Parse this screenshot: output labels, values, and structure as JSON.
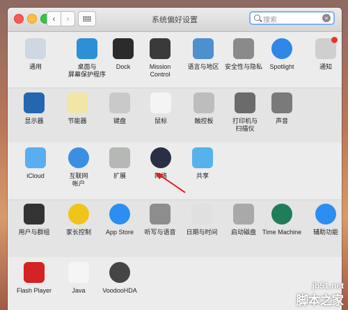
{
  "window": {
    "title": "系统偏好设置"
  },
  "search": {
    "placeholder": "搜索"
  },
  "rows": [
    [
      {
        "label": "通用",
        "icon": "general-icon"
      },
      {
        "label": "桌面与\n屏幕保护程序",
        "icon": "desktop-screensaver-icon"
      },
      {
        "label": "Dock",
        "icon": "dock-icon"
      },
      {
        "label": "Mission\nControl",
        "icon": "mission-control-icon"
      },
      {
        "label": "语言与地区",
        "icon": "language-region-icon"
      },
      {
        "label": "安全性与隐私",
        "icon": "security-privacy-icon"
      },
      {
        "label": "Spotlight",
        "icon": "spotlight-icon"
      },
      {
        "label": "通知",
        "icon": "notifications-icon"
      }
    ],
    [
      {
        "label": "显示器",
        "icon": "displays-icon"
      },
      {
        "label": "节能器",
        "icon": "energy-saver-icon"
      },
      {
        "label": "键盘",
        "icon": "keyboard-icon"
      },
      {
        "label": "鼠标",
        "icon": "mouse-icon"
      },
      {
        "label": "触控板",
        "icon": "trackpad-icon"
      },
      {
        "label": "打印机与\n扫描仪",
        "icon": "printers-scanners-icon"
      },
      {
        "label": "声音",
        "icon": "sound-icon"
      }
    ],
    [
      {
        "label": "iCloud",
        "icon": "icloud-icon"
      },
      {
        "label": "互联网\n帐户",
        "icon": "internet-accounts-icon"
      },
      {
        "label": "扩展",
        "icon": "extensions-icon"
      },
      {
        "label": "网络",
        "icon": "network-icon"
      },
      {
        "label": "共享",
        "icon": "sharing-icon"
      }
    ],
    [
      {
        "label": "用户与群组",
        "icon": "users-groups-icon"
      },
      {
        "label": "家长控制",
        "icon": "parental-controls-icon"
      },
      {
        "label": "App Store",
        "icon": "app-store-icon"
      },
      {
        "label": "听写与语音",
        "icon": "dictation-speech-icon"
      },
      {
        "label": "日期与时间",
        "icon": "date-time-icon"
      },
      {
        "label": "启动磁盘",
        "icon": "startup-disk-icon"
      },
      {
        "label": "Time Machine",
        "icon": "time-machine-icon"
      },
      {
        "label": "辅助功能",
        "icon": "accessibility-icon"
      }
    ],
    [
      {
        "label": "Flash Player",
        "icon": "flash-player-icon"
      },
      {
        "label": "Java",
        "icon": "java-icon"
      },
      {
        "label": "VoodooHDA",
        "icon": "voodoohda-icon"
      }
    ]
  ],
  "watermark": {
    "line1": "jb51.net",
    "line2": "脚本之家"
  }
}
